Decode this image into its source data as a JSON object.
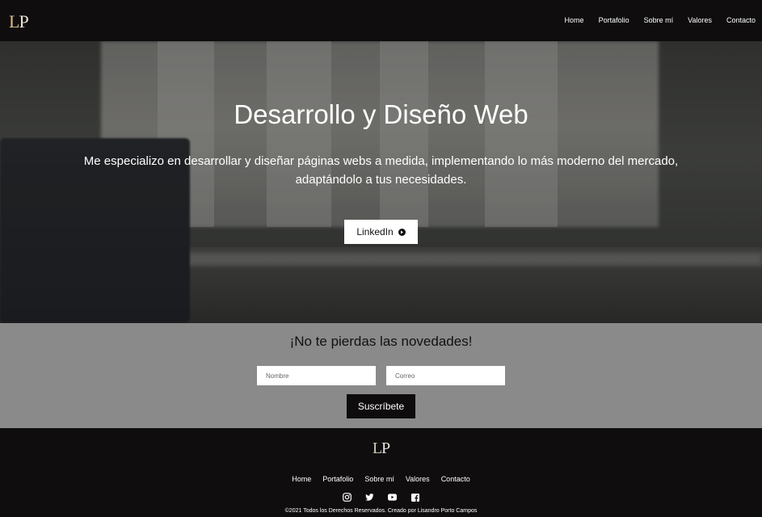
{
  "header": {
    "logo_left": "L",
    "logo_right": "P",
    "nav": [
      "Home",
      "Portafolio",
      "Sobre mí",
      "Valores",
      "Contacto"
    ]
  },
  "hero": {
    "title": "Desarrollo y Diseño Web",
    "text": "Me especializo en desarrollar y diseñar páginas webs a medida, implementando lo más moderno del mercado, adaptándolo a tus necesidades.",
    "button_label": "LinkedIn",
    "button_icon": "arrow-right-circle-icon"
  },
  "newsletter": {
    "title": "¡No te pierdas las novedades!",
    "name_placeholder": "Nombre",
    "email_placeholder": "Correo",
    "submit_label": "Suscríbete"
  },
  "footer": {
    "logo_left": "L",
    "logo_right": "P",
    "nav": [
      "Home",
      "Portafolio",
      "Sobre mí",
      "Valores",
      "Contacto"
    ],
    "social": [
      "instagram-icon",
      "twitter-icon",
      "youtube-icon",
      "facebook-icon"
    ],
    "copyright": "©2021 Todos los Derechos Reservados. Creado por Lisandro Porto Campos"
  },
  "colors": {
    "header_bg": "#0f0d0e",
    "newsletter_bg": "#8a8a8a",
    "logo_gold": "#d8c08a",
    "text_light": "#ffffff"
  }
}
